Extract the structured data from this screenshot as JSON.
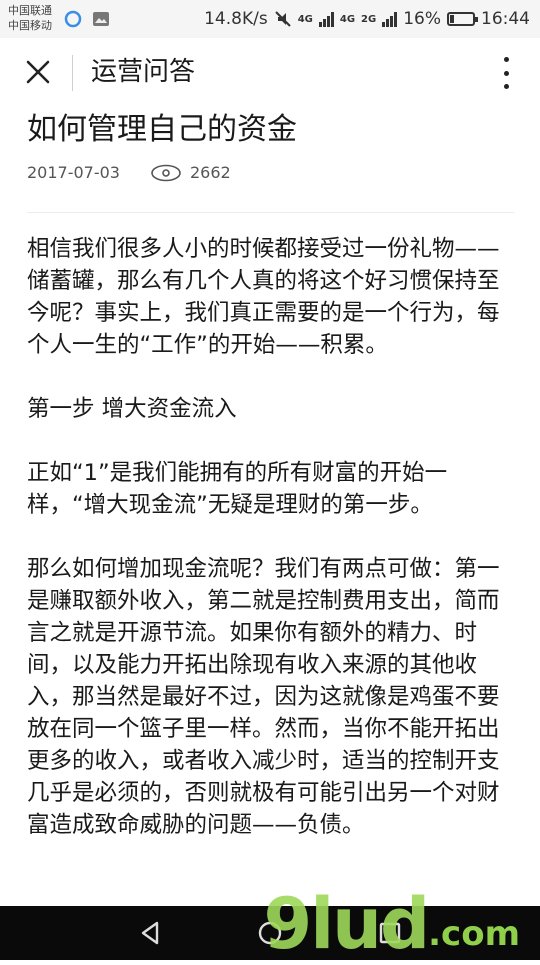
{
  "status_bar": {
    "carrier_1": "中国联通",
    "carrier_2": "中国移动",
    "network_speed": "14.8K/s",
    "network_type_1": "4G",
    "network_type_2": "4G",
    "network_type_3": "2G",
    "battery_percent": "16%",
    "battery_level": 0.16,
    "time": "16:44"
  },
  "header": {
    "title": "运营问答",
    "close_icon": "close-icon",
    "more_icon": "more-vertical-icon"
  },
  "article": {
    "title": "如何管理自己的资金",
    "date": "2017-07-03",
    "views": "2662",
    "paragraphs": [
      "相信我们很多人小的时候都接受过一份礼物——储蓄罐，那么有几个人真的将这个好习惯保持至今呢？事实上，我们真正需要的是一个行为，每个人一生的“工作”的开始——积累。",
      "第一步 增大资金流入",
      "正如“1”是我们能拥有的所有财富的开始一样，“增大现金流”无疑是理财的第一步。",
      "那么如何增加现金流呢？我们有两点可做：第一是赚取额外收入，第二就是控制费用支出，简而言之就是开源节流。如果你有额外的精力、时间，以及能力开拓出除现有收入来源的其他收入，那当然是最好不过，因为这就像是鸡蛋不要放在同一个篮子里一样。然而，当你不能开拓出更多的收入，或者收入减少时，适当的控制开支几乎是必须的，否则就极有可能引出另一个对财富造成致命威胁的问题——负债。"
    ]
  },
  "watermark": {
    "main": "9lud",
    "suffix": ".com"
  },
  "colors": {
    "nav_bar": "#0a0a0a",
    "watermark": "#9ed95a"
  }
}
